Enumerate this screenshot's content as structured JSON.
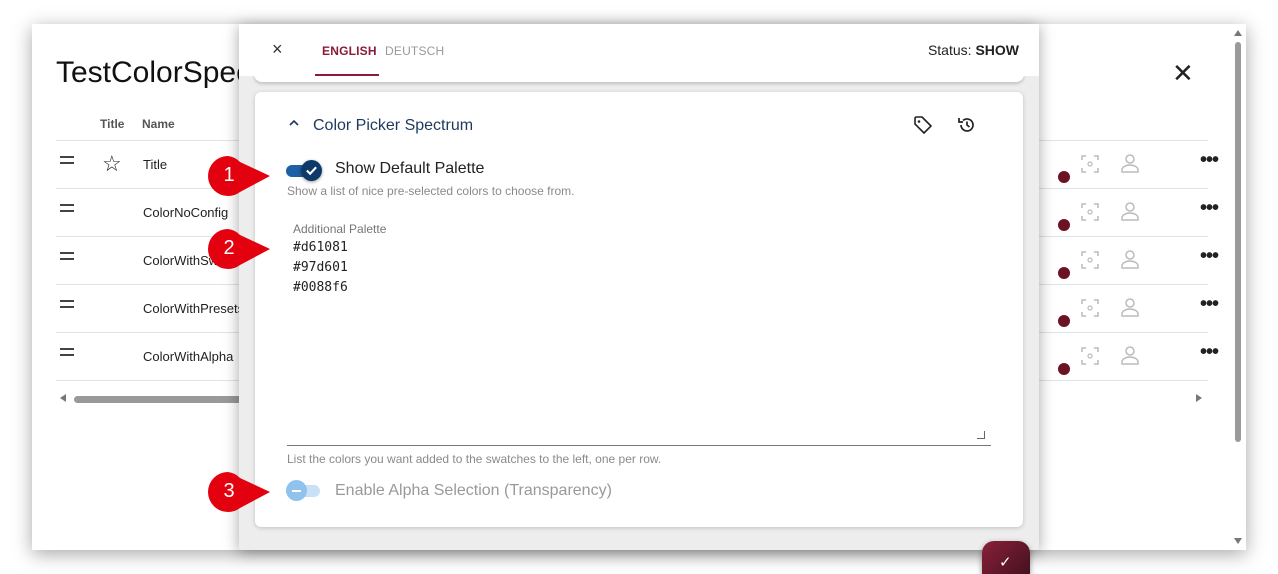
{
  "background_dialog": {
    "title": "TestColorSpec",
    "close_icon": "close-icon",
    "columns": {
      "title": "Title",
      "name": "Name"
    },
    "rows": [
      {
        "name": "Title",
        "has_star": true
      },
      {
        "name": "ColorNoConfig",
        "has_star": false
      },
      {
        "name": "ColorWithSw",
        "has_star": false
      },
      {
        "name": "ColorWithPresets",
        "has_star": false
      },
      {
        "name": "ColorWithAlpha",
        "has_star": false
      }
    ],
    "more_label": "•••"
  },
  "dialog": {
    "close_label": "×",
    "tabs": [
      {
        "label": "ENGLISH",
        "active": true
      },
      {
        "label": "DEUTSCH",
        "active": false
      }
    ],
    "status_prefix": "Status:",
    "status_value": "SHOW",
    "section": {
      "title": "Color Picker Spectrum",
      "icons": [
        "chevron-up-icon",
        "tag-icon",
        "history-icon"
      ],
      "show_default_palette": {
        "label": "Show Default Palette",
        "checked": true,
        "hint": "Show a list of nice pre-selected colors to choose from."
      },
      "additional_palette": {
        "label": "Additional Palette",
        "lines": [
          "#d61081",
          "#97d601",
          "#0088f6"
        ],
        "hint": "List the colors you want added to the swatches to the left, one per row."
      },
      "enable_alpha": {
        "label": "Enable Alpha Selection (Transparency)",
        "checked": false
      }
    },
    "save_button": "✓"
  },
  "callouts": [
    "1",
    "2",
    "3"
  ],
  "colors": {
    "accent": "#8a1b3a",
    "toggle_on": "#0d3a68",
    "toggle_off": "#8fc3ee",
    "callout": "#e3000f"
  }
}
